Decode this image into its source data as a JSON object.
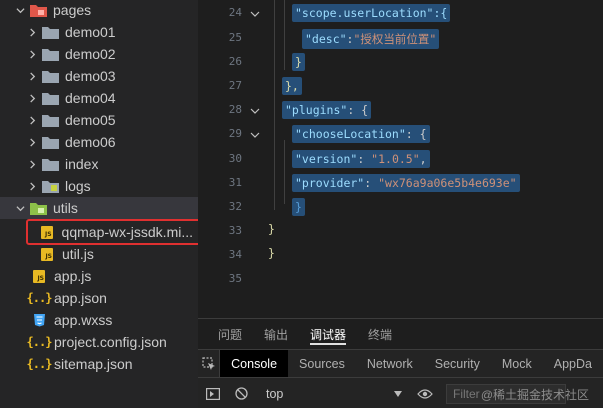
{
  "explorer": {
    "items": [
      {
        "label": "pages",
        "type": "folder-open",
        "icon": "folder-pages-icon"
      },
      {
        "label": "demo01",
        "type": "folder"
      },
      {
        "label": "demo02",
        "type": "folder"
      },
      {
        "label": "demo03",
        "type": "folder"
      },
      {
        "label": "demo04",
        "type": "folder"
      },
      {
        "label": "demo05",
        "type": "folder"
      },
      {
        "label": "demo06",
        "type": "folder"
      },
      {
        "label": "index",
        "type": "folder"
      },
      {
        "label": "logs",
        "type": "folder"
      },
      {
        "label": "utils",
        "type": "folder-open"
      },
      {
        "label": "qqmap-wx-jssdk.mi...",
        "type": "js"
      },
      {
        "label": "util.js",
        "type": "js"
      },
      {
        "label": "app.js",
        "type": "js"
      },
      {
        "label": "app.json",
        "type": "json"
      },
      {
        "label": "app.wxss",
        "type": "wxss"
      },
      {
        "label": "project.config.json",
        "type": "json"
      },
      {
        "label": "sitemap.json",
        "type": "json"
      }
    ],
    "js_badge": "JS",
    "json_badge": "{..}"
  },
  "editor": {
    "lines": [
      {
        "n": "24",
        "text": "\"scope.userLocation\":{"
      },
      {
        "n": "25",
        "key": "\"desc\"",
        "sep": ":",
        "value": "\"授权当前位置\""
      },
      {
        "n": "26",
        "text": "}"
      },
      {
        "n": "27",
        "text": "},"
      },
      {
        "n": "28",
        "key": "\"plugins\"",
        "sep": ": {"
      },
      {
        "n": "29",
        "key": "\"chooseLocation\"",
        "sep": ": {"
      },
      {
        "n": "30",
        "key": "\"version\"",
        "sep": ": ",
        "value": "\"1.0.5\"",
        "tail": ","
      },
      {
        "n": "31",
        "key": "\"provider\"",
        "sep": ": ",
        "value": "\"wx76a9a06e5b4e693e\""
      },
      {
        "n": "32",
        "text": "}"
      },
      {
        "n": "33",
        "text": "}"
      },
      {
        "n": "34",
        "text": "}"
      },
      {
        "n": "35",
        "text": ""
      }
    ]
  },
  "panel": {
    "tabs": [
      "问题",
      "输出",
      "调试器",
      "终端"
    ],
    "active_tab": "调试器"
  },
  "devtools": {
    "tabs": [
      "Console",
      "Sources",
      "Network",
      "Security",
      "Mock",
      "AppDa"
    ],
    "active_tab": "Console",
    "context": "top",
    "filter_placeholder": "Filter",
    "watermark": "@稀土掘金技术社区"
  }
}
